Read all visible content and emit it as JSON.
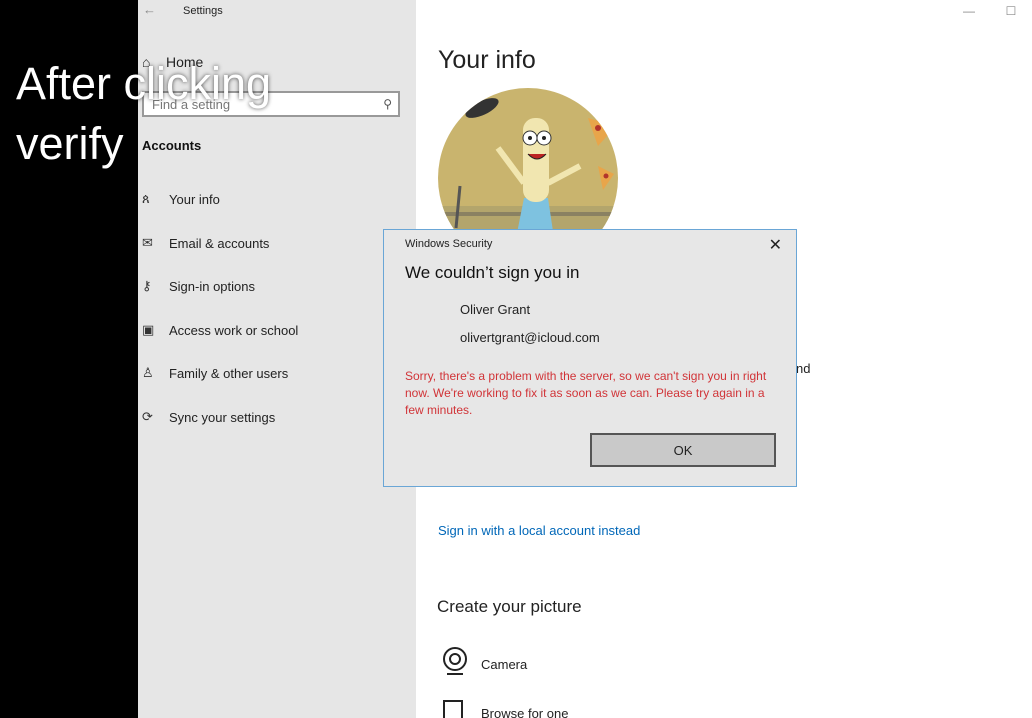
{
  "window": {
    "title": "Settings",
    "back_icon": "←",
    "controls": {
      "minimize": "—",
      "maximize": "☐"
    }
  },
  "sidebar": {
    "home_label": "Home",
    "search_placeholder": "Find a setting",
    "section": "Accounts",
    "items": [
      {
        "label": "Your info",
        "icon": "user-info-icon"
      },
      {
        "label": "Email & accounts",
        "icon": "mail-icon"
      },
      {
        "label": "Sign-in options",
        "icon": "key-icon"
      },
      {
        "label": "Access work or school",
        "icon": "briefcase-icon"
      },
      {
        "label": "Family & other users",
        "icon": "person-add-icon"
      },
      {
        "label": "Sync your settings",
        "icon": "sync-icon"
      }
    ]
  },
  "main": {
    "title": "Your info",
    "partial_text": "nd",
    "local_account_link": "Sign in with a local account instead",
    "create_picture_title": "Create your picture",
    "options": [
      {
        "label": "Camera",
        "icon": "camera-icon"
      },
      {
        "label": "Browse for one",
        "icon": "browse-icon"
      }
    ]
  },
  "overlay": {
    "line1": "After clicking",
    "line2": "verify"
  },
  "dialog": {
    "title": "Windows Security",
    "heading": "We couldn’t sign you in",
    "user_name": "Oliver Grant",
    "user_email": "olivertgrant@icloud.com",
    "error_message": "Sorry, there's a problem with the server, so we can't sign you in right now. We're working to fix it as soon as we can. Please try again in a few minutes.",
    "ok_label": "OK"
  },
  "colors": {
    "accent": "#0067b8",
    "error": "#d13438",
    "dialog_border": "#6aa6d6"
  }
}
